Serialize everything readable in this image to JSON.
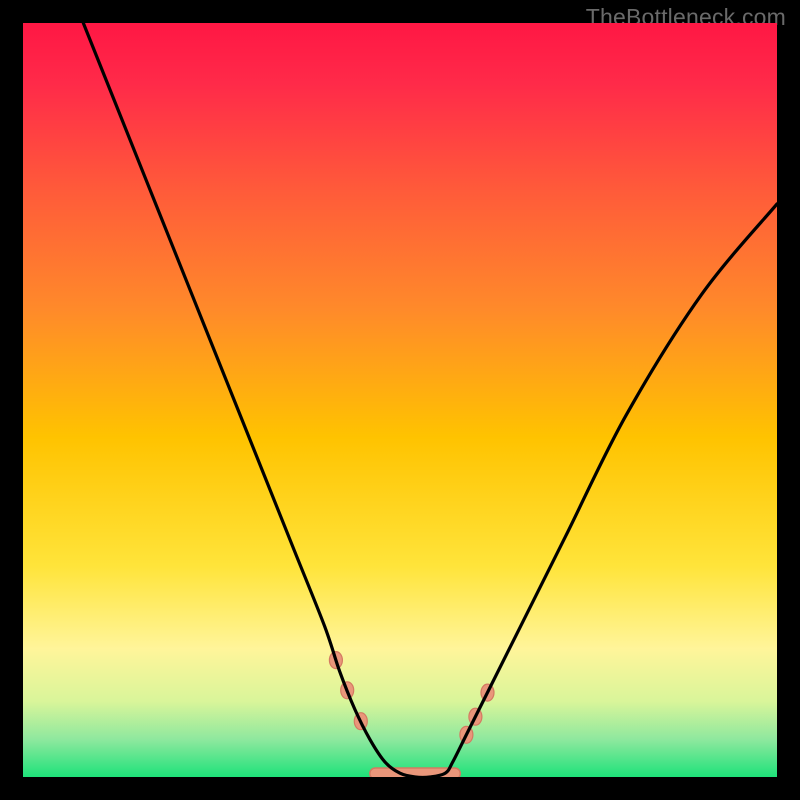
{
  "watermark": "TheBottleneck.com",
  "chart_data": {
    "type": "line",
    "title": "",
    "xlabel": "",
    "ylabel": "",
    "xlim": [
      0,
      100
    ],
    "ylim": [
      0,
      100
    ],
    "background_gradient": {
      "stops": [
        {
          "offset": 0.0,
          "color": "#ff1744"
        },
        {
          "offset": 0.08,
          "color": "#ff2a49"
        },
        {
          "offset": 0.22,
          "color": "#ff5a3a"
        },
        {
          "offset": 0.38,
          "color": "#ff8a2a"
        },
        {
          "offset": 0.55,
          "color": "#ffc300"
        },
        {
          "offset": 0.72,
          "color": "#ffe43a"
        },
        {
          "offset": 0.83,
          "color": "#fff59a"
        },
        {
          "offset": 0.9,
          "color": "#d9f59a"
        },
        {
          "offset": 0.95,
          "color": "#8ee89e"
        },
        {
          "offset": 1.0,
          "color": "#1ee27a"
        }
      ]
    },
    "curve": {
      "description": "Asymmetric V-shaped bottleneck curve with flat valley",
      "x": [
        8,
        12,
        16,
        20,
        24,
        28,
        32,
        36,
        40,
        42,
        44,
        46,
        48,
        50,
        52,
        54,
        56,
        57,
        59,
        62,
        66,
        72,
        80,
        90,
        100
      ],
      "y": [
        100,
        90,
        80,
        70,
        60,
        50,
        40,
        30,
        20,
        14,
        9,
        5,
        2,
        0.5,
        0,
        0,
        0.5,
        2,
        6,
        12,
        20,
        32,
        48,
        64,
        76
      ]
    },
    "colors": {
      "curve": "#000000",
      "valley_marker": "#e9967a",
      "valley_marker_stroke": "#d47a62"
    },
    "valley_markers": {
      "description": "Salmon chain-of-dots/rounded-bar cluster at valley bottom",
      "x_center": 52,
      "width": 12,
      "y": 0
    }
  }
}
